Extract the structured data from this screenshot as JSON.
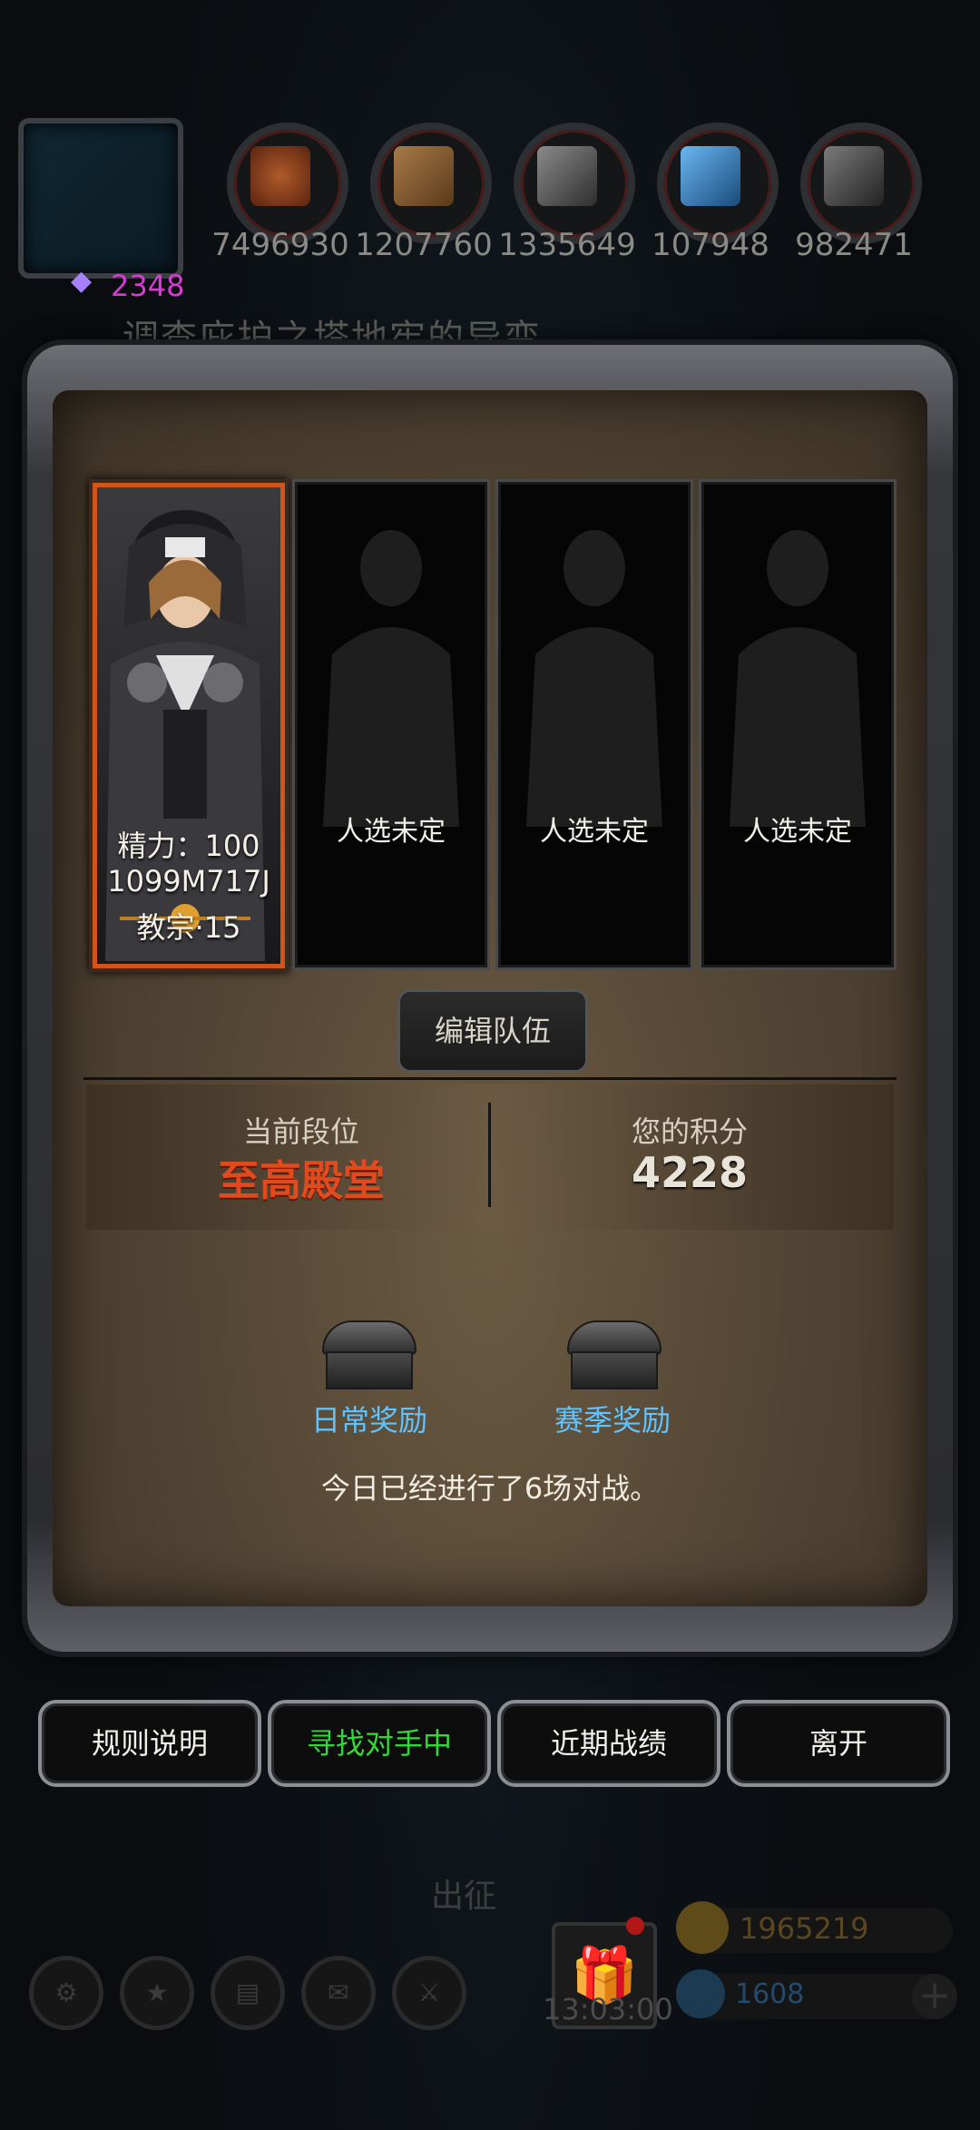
{
  "header": {
    "resources": [
      {
        "name": "ore-icon",
        "value": "7496930",
        "color": "#8a3e1c"
      },
      {
        "name": "wood-icon",
        "value": "1207760",
        "color": "#6a4a2a"
      },
      {
        "name": "iron-icon",
        "value": "1335649",
        "color": "#5a5a5a"
      },
      {
        "name": "crystal-icon",
        "value": "107948",
        "color": "#2a5c88"
      },
      {
        "name": "steel-icon",
        "value": "982471",
        "color": "#4a4a4a"
      }
    ],
    "crystal_count": "2348",
    "quest_text": "调查庇护之塔地牢的异变"
  },
  "party": {
    "hero": {
      "energy": "精力：100",
      "code": "1099M717J",
      "class_level": "教宗·15"
    },
    "empty_label": "人选未定",
    "edit_button": "编辑队伍"
  },
  "rank": {
    "current_label": "当前段位",
    "current_value": "至高殿堂",
    "current_color": "#e04a1c",
    "score_label": "您的积分",
    "score_value": "4228"
  },
  "rewards": {
    "daily": "日常奖励",
    "season": "赛季奖励",
    "battle_text": "今日已经进行了6场对战。"
  },
  "buttons": {
    "rules": "规则说明",
    "searching": "寻找对手中",
    "recent": "近期战绩",
    "leave": "离开"
  },
  "hud": {
    "sortie": "出征",
    "timer": "13:03:00",
    "gold": "1965219",
    "gems": "1608"
  }
}
